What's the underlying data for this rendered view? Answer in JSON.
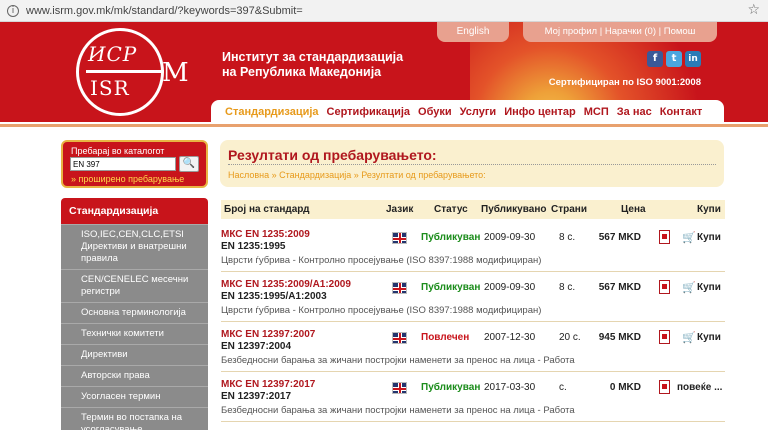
{
  "browser": {
    "url": "www.isrm.gov.mk/mk/standard/?keywords=397&Submit="
  },
  "header": {
    "logo_top": "ИСР",
    "logo_bottom": "ISR",
    "logo_m": "M",
    "org_line1": "Институт за стандардизација",
    "org_line2": "на Република Македонија",
    "certified": "Сертифициран по ISO 9001:2008",
    "lang": "English",
    "profile": "Мој профил",
    "orders": "Нарачки (0)",
    "help": "Помош",
    "social": {
      "facebook": "f",
      "twitter": "t",
      "linkedin": "in"
    }
  },
  "nav": {
    "items": [
      "Стандардизација",
      "Сертификација",
      "Обуки",
      "Услуги",
      "Инфо центар",
      "МСП",
      "За нас",
      "Контакт"
    ]
  },
  "search": {
    "label": "Пребарај во каталогот",
    "value": "EN 397",
    "advanced": "» проширено пребарување"
  },
  "sidebar": {
    "title": "Стандардизација",
    "items": [
      "ISO,IEC,CEN,CLC,ETSI Директиви и внатрешни правила",
      "CEN/CENELEC месечни регистри",
      "Основна терминологија",
      "Технички комитети",
      "Директиви",
      "Авторски права",
      "Усогласен термин",
      "Термин во постапка на усогласување"
    ]
  },
  "results": {
    "title": "Резултати од пребарувањето:",
    "breadcrumb": "Насловна » Стандардизација » Резултати од пребарувањето:",
    "columns": [
      "Број на стандард",
      "Јазик",
      "Статус",
      "Публикувано",
      "Страни",
      "Цена",
      "Купи"
    ],
    "rows": [
      {
        "std": "МКС EN 1235:2009",
        "std2": "EN 1235:1995",
        "title": "Цврсти ѓубрива - Контролно просејување (ISO 8397:1988 модифициран)",
        "status": "Публикуван",
        "status_color": "#1a8c1a",
        "date": "2009-09-30",
        "pages": "8 с.",
        "price": "567 MKD",
        "buy": "Купи"
      },
      {
        "std": "МКС EN 1235:2009/A1:2009",
        "std2": "EN 1235:1995/A1:2003",
        "title": "Цврсти ѓубрива - Контролно просејување (ISO 8397:1988 модифициран)",
        "status": "Публикуван",
        "status_color": "#1a8c1a",
        "date": "2009-09-30",
        "pages": "8 с.",
        "price": "567 MKD",
        "buy": "Купи"
      },
      {
        "std": "МКС EN 12397:2007",
        "std2": "EN 12397:2004",
        "title": "Безбедносни барања за жичани постројки наменети за пренос на лица - Работа",
        "status": "Повлечен",
        "status_color": "#c8141b",
        "date": "2007-12-30",
        "pages": "20 с.",
        "price": "945 MKD",
        "buy": "Купи"
      },
      {
        "std": "МКС EN 12397:2017",
        "std2": "EN 12397:2017",
        "title": "Безбедносни барања за жичани постројки наменети за пренос на лица - Работа",
        "status": "Публикуван",
        "status_color": "#1a8c1a",
        "date": "2017-03-30",
        "pages": "с.",
        "price": "0 MKD",
        "buy": "повеќе ..."
      }
    ]
  },
  "colors": {
    "brand_red": "#c8141b",
    "accent_orange": "#e79a1b",
    "cream": "#faf0cf"
  }
}
